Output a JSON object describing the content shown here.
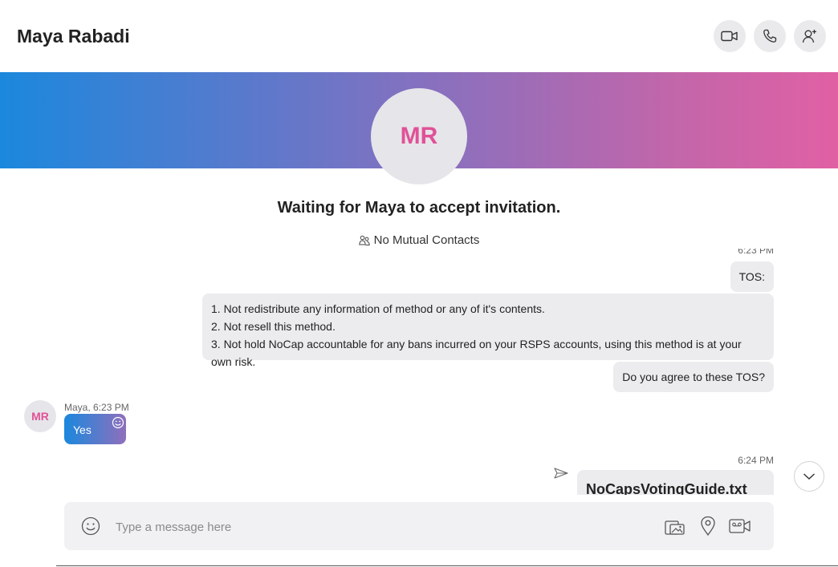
{
  "header": {
    "contact_name": "Maya Rabadi",
    "buttons": [
      {
        "icon": "video-call-icon"
      },
      {
        "icon": "phone-icon"
      },
      {
        "icon": "add-person-icon"
      }
    ]
  },
  "profile": {
    "initials": "MR",
    "status_text": "Waiting for Maya to accept invitation.",
    "mutual_contacts": "No Mutual Contacts"
  },
  "messages": {
    "top_timestamp": "6:23 PM",
    "outgoing_1": "TOS:",
    "tos_items": [
      "1. Not redistribute any information of method or any of it's contents.",
      "2. Not resell this method.",
      "3. Not hold NoCap accountable for any bans incurred on your RSPS accounts, using this method is at your own risk."
    ],
    "outgoing_2": "Do you agree to these TOS?",
    "incoming": {
      "avatar_initials": "MR",
      "meta": "Maya, 6:23 PM",
      "text": "Yes"
    },
    "file_timestamp": "6:24 PM",
    "file_name": "NoCapsVotingGuide.txt"
  },
  "composer": {
    "placeholder": "Type a message here",
    "icons": [
      "emoji-icon",
      "media-gallery-icon",
      "location-icon",
      "video-message-icon"
    ]
  },
  "colors": {
    "accent_pink": "#e05297",
    "gradient_start": "#1b88dd",
    "gradient_end": "#e160a4"
  }
}
